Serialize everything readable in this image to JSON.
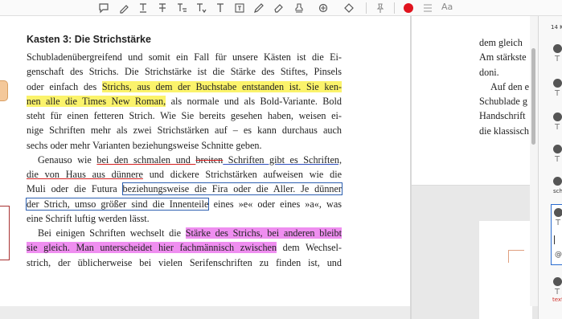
{
  "toolbar": {
    "icons": [
      "comment-icon",
      "highlight-icon",
      "text-underline-icon",
      "text-strikethrough-icon",
      "replace-text-icon",
      "insert-text-icon",
      "textbox-icon",
      "pencil-icon",
      "eraser-icon",
      "stamp-icon",
      "attach-icon",
      "shapes-icon",
      "pin-icon",
      "color-dot-icon",
      "line-weight-icon",
      "font-size-icon"
    ],
    "active_color": "#e0141e",
    "font_label": "Aa"
  },
  "document": {
    "heading": "Kasten 3: Die Strichstärke",
    "p1": [
      "Schubladenübergreifend und somit ein Fall für unsere Kästen ist die Ei-",
      "genschaft des Strichs. Die Strichstärke ist die Stärke des Stiftes, Pinsels",
      {
        "pre": "oder einfach des ",
        "hl": "Strichs, aus dem der Buchstabe entstanden ist. Sie ken-"
      },
      {
        "hl": "nen alle die Times New Roman,",
        "post": " als normale und als Bold-Variante. Bold"
      },
      "steht für einen fetteren Strich. Wie Sie bereits gesehen haben, weisen ei-",
      "nige Schriften mehr als zwei Strichstärken auf – es kann durchaus auch",
      "sechs oder mehr Varianten beziehungsweise Schnitte geben."
    ],
    "p2": {
      "l1_a": "Genauso wie ",
      "l1_b": "bei den schmalen und ",
      "l1_strike": "breiten",
      "l1_c": " Schriften gibt es Schriften,",
      "l2_a": "die von Haus aus dünnere",
      "l2_b": " und dickere Strichstärken aufweisen wie die",
      "l3_a": "Muli oder die Futura ",
      "l3_box": "beziehungsweise die Fira oder die Aller. Je dünner",
      "l4_box": "der Strich, umso größer sind die Innenteile",
      "l4_b": " eines »e« oder eines »a«, was",
      "l5": "eine Schrift luftig werden lässt."
    },
    "p3": {
      "l1_a": "Bei einigen Schriften wechselt die ",
      "l1_hl": "Stärke des Strichs, bei anderen bleibt",
      "l2_hl": "sie gleich. Man unterscheidet hier fachmännisch zwischen",
      "l2_b": " dem Wechsel-",
      "l3": "strich, der üblicherweise bei vielen Serifenschriften zu finden ist, und"
    }
  },
  "right_page": {
    "lines": [
      "dem gleich",
      "Am stärkste",
      "doni.",
      "Auf den e",
      "Schublade g",
      "Handschrift",
      "die klassisch"
    ]
  },
  "comments_panel": {
    "count_label": "14 K",
    "schr_label": "schr",
    "text_label": "text",
    "at_symbol": "@",
    "item_glyph": "T"
  }
}
